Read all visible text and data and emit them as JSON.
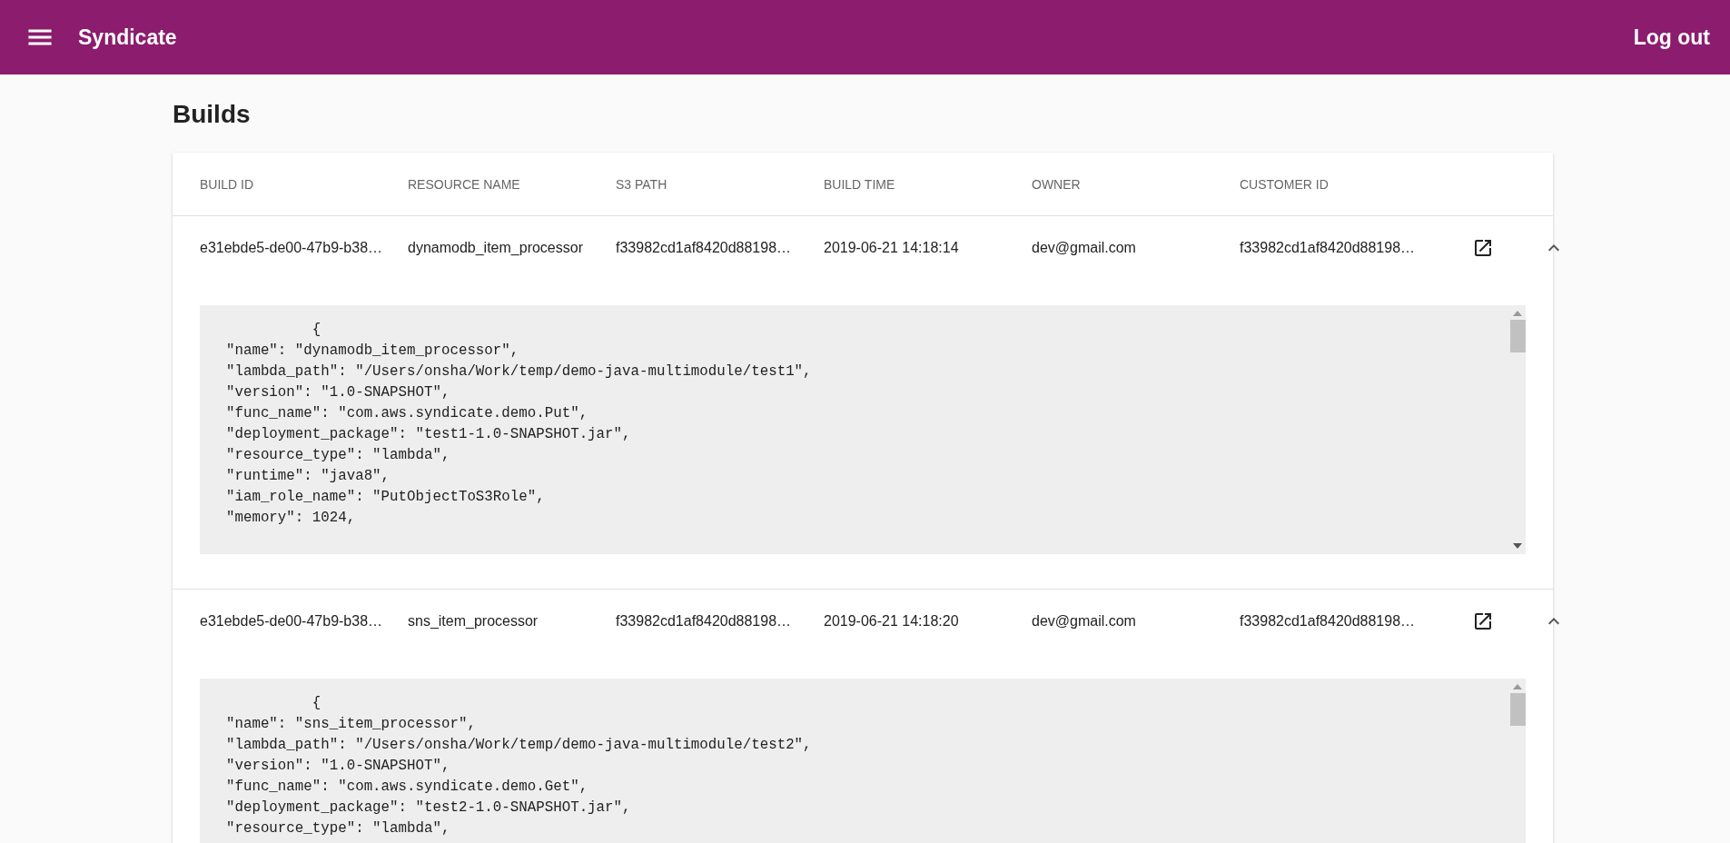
{
  "app_bar": {
    "title": "Syndicate",
    "logout": "Log out"
  },
  "page_title": "Builds",
  "table": {
    "columns": [
      "BUILD ID",
      "RESOURCE NAME",
      "S3 PATH",
      "BUILD TIME",
      "OWNER",
      "CUSTOMER ID"
    ],
    "rows": [
      {
        "cells": [
          "e31ebde5-de00-47b9-b38…",
          "dynamodb_item_processor",
          "f33982cd1af8420d88198…",
          "2019-06-21 14:18:14",
          "dev@gmail.com",
          "f33982cd1af8420d88198…"
        ],
        "expanded": true,
        "details": [
          "            {",
          "  \"name\": \"dynamodb_item_processor\",",
          "  \"lambda_path\": \"/Users/onsha/Work/temp/demo-java-multimodule/test1\",",
          "  \"version\": \"1.0-SNAPSHOT\",",
          "  \"func_name\": \"com.aws.syndicate.demo.Put\",",
          "  \"deployment_package\": \"test1-1.0-SNAPSHOT.jar\",",
          "  \"resource_type\": \"lambda\",",
          "  \"runtime\": \"java8\",",
          "  \"iam_role_name\": \"PutObjectToS3Role\",",
          "  \"memory\": 1024,"
        ]
      },
      {
        "cells": [
          "e31ebde5-de00-47b9-b38…",
          "sns_item_processor",
          "f33982cd1af8420d88198…",
          "2019-06-21 14:18:20",
          "dev@gmail.com",
          "f33982cd1af8420d88198…"
        ],
        "expanded": true,
        "details": [
          "            {",
          "  \"name\": \"sns_item_processor\",",
          "  \"lambda_path\": \"/Users/onsha/Work/temp/demo-java-multimodule/test2\",",
          "  \"version\": \"1.0-SNAPSHOT\",",
          "  \"func_name\": \"com.aws.syndicate.demo.Get\",",
          "  \"deployment_package\": \"test2-1.0-SNAPSHOT.jar\",",
          "  \"resource_type\": \"lambda\","
        ]
      }
    ]
  }
}
